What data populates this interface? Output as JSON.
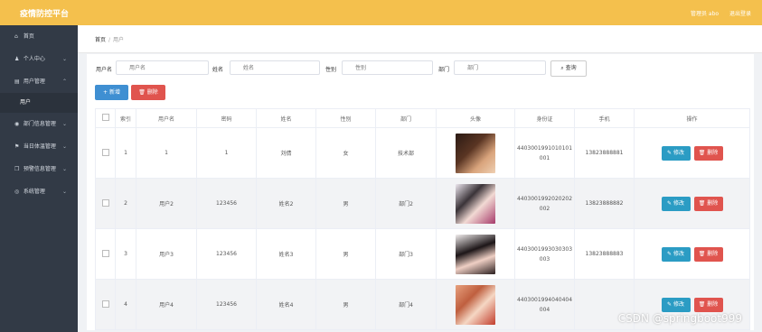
{
  "app": {
    "title": "疫情防控平台"
  },
  "header": {
    "user_text": "管理员 abo",
    "logout": "退出登录"
  },
  "sidebar": {
    "items": [
      {
        "icon": "home-icon",
        "glyph": "⌂",
        "label": "首页"
      },
      {
        "icon": "user-icon",
        "glyph": "♟",
        "label": "个人中心",
        "arrow": "⌄"
      },
      {
        "icon": "list-icon",
        "glyph": "▤",
        "label": "用户管理",
        "arrow": "⌃"
      },
      {
        "icon": "",
        "glyph": "",
        "label": "用户",
        "sub": true
      },
      {
        "icon": "location-icon",
        "glyph": "◉",
        "label": "部门信息管理",
        "arrow": "⌄"
      },
      {
        "icon": "flag-icon",
        "glyph": "⚑",
        "label": "当日体温管理",
        "arrow": "⌄"
      },
      {
        "icon": "copy-icon",
        "glyph": "❐",
        "label": "预警信息管理",
        "arrow": "⌄"
      },
      {
        "icon": "settings-icon",
        "glyph": "◎",
        "label": "系统管理",
        "arrow": "⌄"
      }
    ]
  },
  "breadcrumb": {
    "home": "首页",
    "sep": "/",
    "current": "用户"
  },
  "search": {
    "username_label": "用户名",
    "username_placeholder": "用户名",
    "name_label": "姓名",
    "name_placeholder": "姓名",
    "gender_label": "性别",
    "gender_placeholder": "性别",
    "dept_label": "部门",
    "dept_placeholder": "部门",
    "query_label": "查询"
  },
  "toolbar": {
    "add_label": "新增",
    "delete_label": "删除"
  },
  "table": {
    "headers": [
      "",
      "索引",
      "用户名",
      "密码",
      "姓名",
      "性别",
      "部门",
      "头像",
      "身份证",
      "手机",
      "操作"
    ],
    "rows": [
      {
        "index": "1",
        "username": "1",
        "password": "1",
        "name": "刘倩",
        "gender": "女",
        "dept": "技术部",
        "id_line1": "4403001991010101",
        "id_line2": "001",
        "phone": "13823888881"
      },
      {
        "index": "2",
        "username": "用户2",
        "password": "123456",
        "name": "姓名2",
        "gender": "男",
        "dept": "部门2",
        "id_line1": "4403001992020202",
        "id_line2": "002",
        "phone": "13823888882"
      },
      {
        "index": "3",
        "username": "用户3",
        "password": "123456",
        "name": "姓名3",
        "gender": "男",
        "dept": "部门3",
        "id_line1": "4403001993030303",
        "id_line2": "003",
        "phone": "13823888883"
      },
      {
        "index": "4",
        "username": "用户4",
        "password": "123456",
        "name": "姓名4",
        "gender": "男",
        "dept": "部门4",
        "id_line1": "4403001994040404",
        "id_line2": "004",
        "phone": ""
      }
    ],
    "edit_label": "修改",
    "delete_label": "删除"
  },
  "watermark": "CSDN @springboot999"
}
